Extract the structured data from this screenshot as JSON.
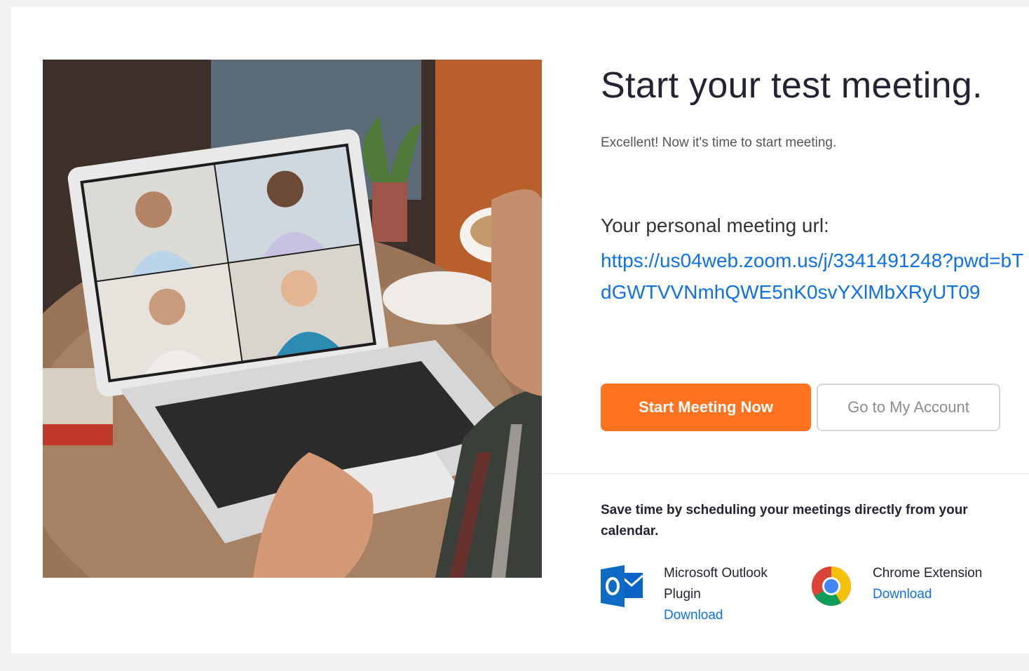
{
  "page": {
    "title": "Start your test meeting.",
    "subtitle": "Excellent! Now it's time to start meeting."
  },
  "meeting": {
    "url_label": "Your personal meeting url:",
    "url": "https://us04web.zoom.us/j/3341491248?pwd=bTdGWTVVNmhQWE5nK0svYXlMbXRyUT09"
  },
  "actions": {
    "start_label": "Start Meeting Now",
    "account_label": "Go to My Account"
  },
  "promo": {
    "text": "Save time by scheduling your meetings directly from your calendar."
  },
  "plugins": {
    "outlook": {
      "name": "Microsoft Outlook\nPlugin",
      "link": "Download",
      "icon": "outlook-icon"
    },
    "chrome": {
      "name": "Chrome Extension",
      "link": "Download",
      "icon": "chrome-icon"
    }
  },
  "colors": {
    "accent": "#ff7220",
    "link": "#0e71eb",
    "text": "#232333"
  }
}
